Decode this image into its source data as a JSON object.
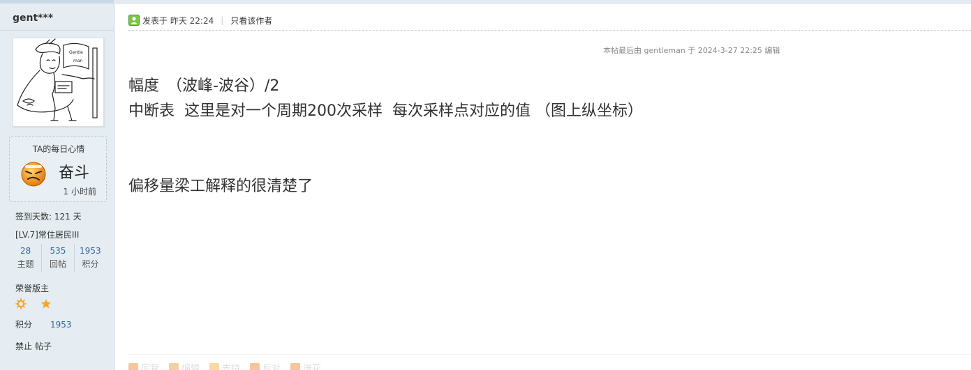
{
  "author": {
    "username": "gent***",
    "mood": {
      "title": "TA的每日心情",
      "status": "奋斗",
      "time": "1 小时前"
    },
    "signin": "签到天数: 121 天",
    "level": "[LV.7]常住居民III",
    "stats": [
      {
        "num": "28",
        "label": "主题"
      },
      {
        "num": "535",
        "label": "回帖"
      },
      {
        "num": "1953",
        "label": "积分"
      }
    ],
    "rank": "荣誉版主",
    "credit_label": "积分",
    "credit_value": "1953",
    "ban_label": "禁止",
    "posts_label": "帖子"
  },
  "post": {
    "posted_label": "发表于 昨天 22:24",
    "author_only": "只看该作者",
    "edited_note": "本帖最后由 gentleman 于 2024-3-27 22:25 编辑",
    "content": {
      "line1": "幅度　（波峰-波谷）/2",
      "line2": "中断表  这里是对一个周期200次采样  每次采样点对应的值 （图上纵坐标）",
      "line3": "偏移量梁工解释的很清楚了"
    },
    "actions": [
      "回复",
      "编辑",
      "支持",
      "反对",
      "送花"
    ]
  },
  "colors": {
    "sidebar_bg": "#e5edf2",
    "link_blue": "#336699",
    "medal_orange": "#f5a623"
  }
}
